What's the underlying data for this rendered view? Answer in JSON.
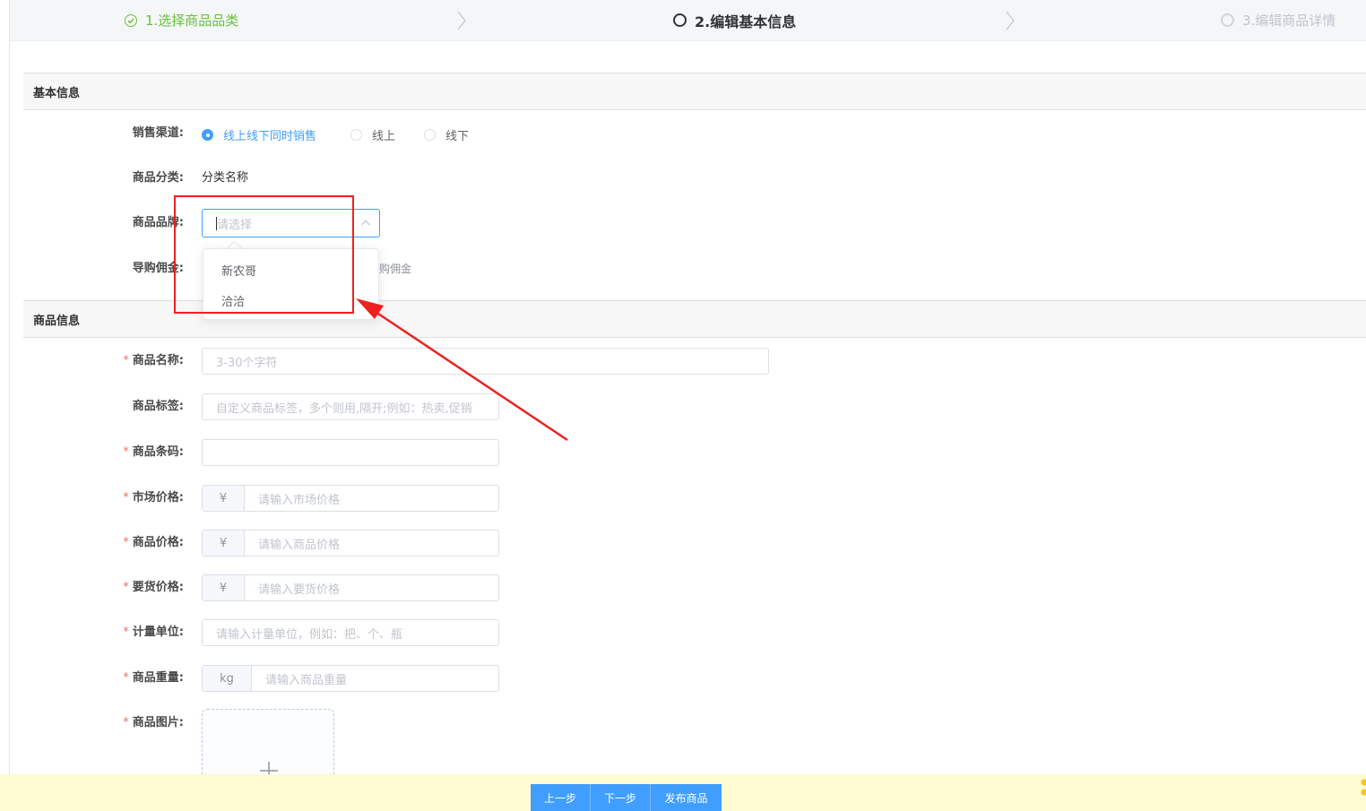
{
  "steps": [
    {
      "label": "1.选择商品品类",
      "state": "done"
    },
    {
      "label": "2.编辑基本信息",
      "state": "active"
    },
    {
      "label": "3.编辑商品详情",
      "state": "pending"
    }
  ],
  "sections": {
    "basic": "基本信息",
    "product": "商品信息"
  },
  "basic": {
    "channel_label": "销售渠道:",
    "channel_options": [
      "线上线下同时销售",
      "线上",
      "线下"
    ],
    "channel_selected": "线上线下同时销售",
    "category_label": "商品分类:",
    "category_value": "分类名称",
    "brand_label": "商品品牌:",
    "brand_placeholder": "请选择",
    "brand_options": [
      "新农哥",
      "洽洽"
    ],
    "commission_label": "导购佣金:",
    "commission_hint_fragment": "购佣金"
  },
  "product": {
    "name_label": "商品名称:",
    "name_placeholder": "3-30个字符",
    "tags_label": "商品标签:",
    "tags_placeholder": "自定义商品标签，多个则用,隔开;例如：热卖,促销",
    "barcode_label": "商品条码:",
    "market_price_label": "市场价格:",
    "market_price_placeholder": "请输入市场价格",
    "price_label": "商品价格:",
    "price_placeholder": "请输入商品价格",
    "order_price_label": "要货价格:",
    "order_price_placeholder": "请输入要货价格",
    "currency_prefix": "¥",
    "unit_label": "计量单位:",
    "unit_placeholder": "请输入计量单位，例如：把、个、瓶",
    "weight_label": "商品重量:",
    "weight_prefix": "kg",
    "weight_placeholder": "请输入商品重量",
    "image_label": "商品图片:",
    "required_mark": "*"
  },
  "footer": {
    "prev": "上一步",
    "next": "下一步",
    "publish": "发布商品"
  },
  "colors": {
    "primary": "#409eff",
    "success": "#67c23a",
    "required": "#f56c6c",
    "highlight": "#f02020",
    "footer_bg": "#fffbd2"
  }
}
